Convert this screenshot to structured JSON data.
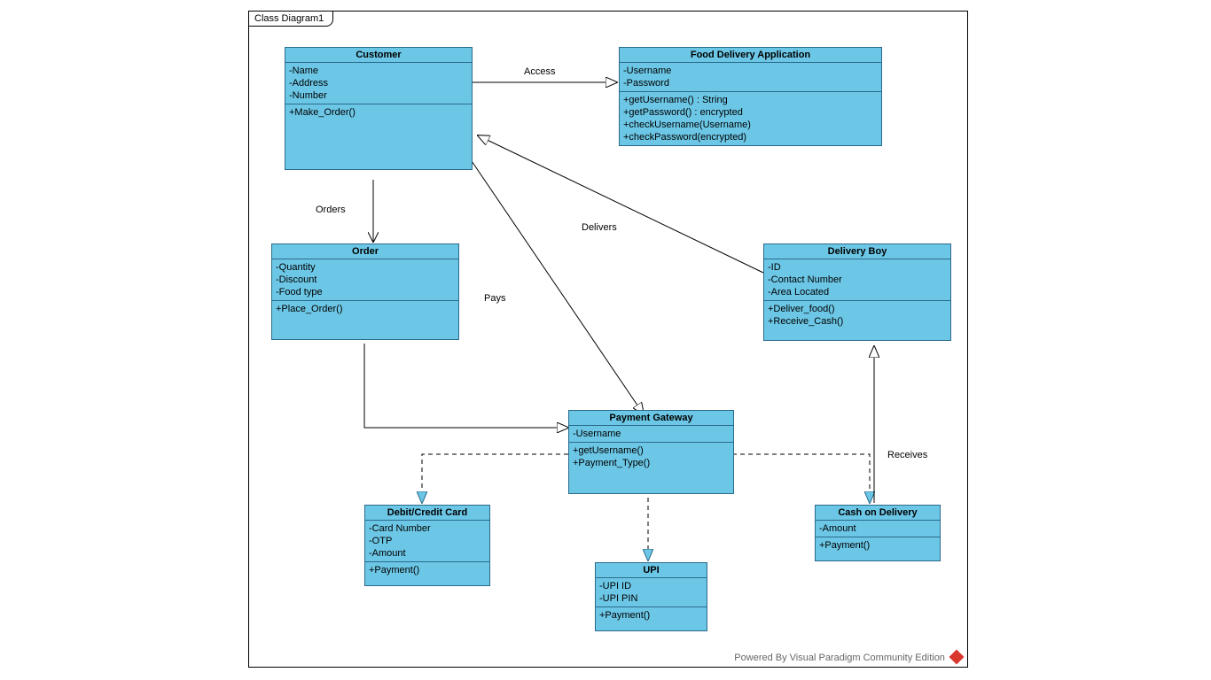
{
  "diagram": {
    "title": "Class Diagram1",
    "footer": "Powered By  Visual Paradigm Community Edition"
  },
  "classes": {
    "customer": {
      "name": "Customer",
      "attrs": [
        "-Name",
        "-Address",
        "-Number"
      ],
      "ops": [
        "+Make_Order()"
      ]
    },
    "fda": {
      "name": "Food Delivery Application",
      "attrs": [
        "-Username",
        "-Password"
      ],
      "ops": [
        "+getUsername() : String",
        "+getPassword() : encrypted",
        "+checkUsername(Username)",
        "+checkPassword(encrypted)"
      ]
    },
    "order": {
      "name": "Order",
      "attrs": [
        "-Quantity",
        "-Discount",
        "-Food type"
      ],
      "ops": [
        "+Place_Order()"
      ]
    },
    "deliveryboy": {
      "name": "Delivery Boy",
      "attrs": [
        "-ID",
        "-Contact Number",
        "-Area Located"
      ],
      "ops": [
        "+Deliver_food()",
        "+Receive_Cash()"
      ]
    },
    "gateway": {
      "name": "Payment Gateway",
      "attrs": [
        "-Username"
      ],
      "ops": [
        "+getUsername()",
        "+Payment_Type()"
      ]
    },
    "card": {
      "name": "Debit/Credit Card",
      "attrs": [
        "-Card Number",
        "-OTP",
        "-Amount"
      ],
      "ops": [
        "+Payment()"
      ]
    },
    "upi": {
      "name": "UPI",
      "attrs": [
        "-UPI ID",
        "-UPI PIN"
      ],
      "ops": [
        "+Payment()"
      ]
    },
    "cod": {
      "name": "Cash on Delivery",
      "attrs": [
        "-Amount"
      ],
      "ops": [
        "+Payment()"
      ]
    }
  },
  "labels": {
    "access": "Access",
    "orders": "Orders",
    "delivers": "Delivers",
    "pays": "Pays",
    "receives": "Receives"
  },
  "chart_data": {
    "type": "uml_class_diagram",
    "title": "Class Diagram1",
    "classes": [
      {
        "id": "Customer",
        "attributes": [
          "-Name",
          "-Address",
          "-Number"
        ],
        "operations": [
          "+Make_Order()"
        ]
      },
      {
        "id": "Food Delivery Application",
        "attributes": [
          "-Username",
          "-Password"
        ],
        "operations": [
          "+getUsername() : String",
          "+getPassword() : encrypted",
          "+checkUsername(Username)",
          "+checkPassword(encrypted)"
        ]
      },
      {
        "id": "Order",
        "attributes": [
          "-Quantity",
          "-Discount",
          "-Food type"
        ],
        "operations": [
          "+Place_Order()"
        ]
      },
      {
        "id": "Delivery Boy",
        "attributes": [
          "-ID",
          "-Contact Number",
          "-Area Located"
        ],
        "operations": [
          "+Deliver_food()",
          "+Receive_Cash()"
        ]
      },
      {
        "id": "Payment Gateway",
        "attributes": [
          "-Username"
        ],
        "operations": [
          "+getUsername()",
          "+Payment_Type()"
        ]
      },
      {
        "id": "Debit/Credit Card",
        "attributes": [
          "-Card Number",
          "-OTP",
          "-Amount"
        ],
        "operations": [
          "+Payment()"
        ]
      },
      {
        "id": "UPI",
        "attributes": [
          "-UPI ID",
          "-UPI PIN"
        ],
        "operations": [
          "+Payment()"
        ]
      },
      {
        "id": "Cash on Delivery",
        "attributes": [
          "-Amount"
        ],
        "operations": [
          "+Payment()"
        ]
      }
    ],
    "relationships": [
      {
        "from": "Customer",
        "to": "Food Delivery Application",
        "label": "Access",
        "style": "solid",
        "arrow": "open_triangle"
      },
      {
        "from": "Customer",
        "to": "Order",
        "label": "Orders",
        "style": "solid",
        "arrow": "open_arrow"
      },
      {
        "from": "Delivery Boy",
        "to": "Customer",
        "label": "Delivers",
        "style": "solid",
        "arrow": "open_triangle"
      },
      {
        "from": "Customer",
        "to": "Payment Gateway",
        "label": "Pays",
        "style": "solid",
        "arrow": "open_triangle",
        "via": "Order"
      },
      {
        "from": "Order",
        "to": "Payment Gateway",
        "label": "",
        "style": "solid",
        "arrow": "open_triangle"
      },
      {
        "from": "Payment Gateway",
        "to": "Debit/Credit Card",
        "style": "dashed",
        "arrow": "open_triangle"
      },
      {
        "from": "Payment Gateway",
        "to": "UPI",
        "style": "dashed",
        "arrow": "open_triangle"
      },
      {
        "from": "Payment Gateway",
        "to": "Cash on Delivery",
        "style": "dashed",
        "arrow": "open_triangle"
      },
      {
        "from": "Cash on Delivery",
        "to": "Delivery Boy",
        "label": "Receives",
        "style": "solid",
        "arrow": "open_triangle"
      }
    ]
  }
}
